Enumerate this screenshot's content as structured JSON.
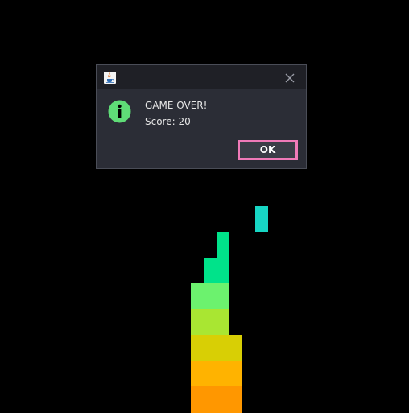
{
  "dialog": {
    "title": "",
    "message_line1": "GAME OVER!",
    "message_line2": "Score: 20",
    "ok_label": "OK",
    "icon": "info-icon",
    "title_icon": "java-cup-icon",
    "close_icon": "close-icon",
    "colors": {
      "background": "#2b2d36",
      "titlebar": "#1f2026",
      "info_icon": "#5fdc77",
      "ok_border": "#f07ab8"
    }
  },
  "board": {
    "background": "#000000",
    "falling_piece_color": "#17d6c4",
    "stack_colors": [
      "#00e38a",
      "#6cf26e",
      "#a9e632",
      "#d8cf05",
      "#ffb300",
      "#ff9700"
    ]
  }
}
